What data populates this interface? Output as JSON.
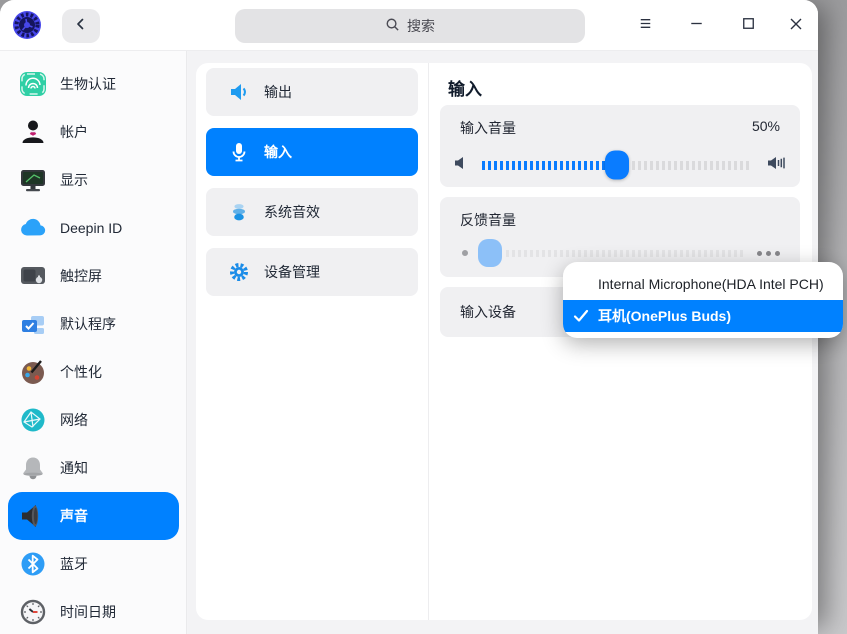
{
  "titlebar": {
    "search_placeholder": "搜索"
  },
  "sidebar": {
    "selected_index": 9,
    "items": [
      {
        "label": "生物认证",
        "icon": "fingerprint-icon",
        "selected": false
      },
      {
        "label": "帐户",
        "icon": "user-icon",
        "selected": false
      },
      {
        "label": "显示",
        "icon": "display-icon",
        "selected": false
      },
      {
        "label": "Deepin ID",
        "icon": "cloud-icon",
        "selected": false
      },
      {
        "label": "触控屏",
        "icon": "touchscreen-icon",
        "selected": false
      },
      {
        "label": "默认程序",
        "icon": "default-apps-icon",
        "selected": false
      },
      {
        "label": "个性化",
        "icon": "personalization-icon",
        "selected": false
      },
      {
        "label": "网络",
        "icon": "network-icon",
        "selected": false
      },
      {
        "label": "通知",
        "icon": "bell-icon",
        "selected": false
      },
      {
        "label": "声音",
        "icon": "speaker-icon",
        "selected": true
      },
      {
        "label": "蓝牙",
        "icon": "bluetooth-icon",
        "selected": false
      },
      {
        "label": "时间日期",
        "icon": "clock-icon",
        "selected": false
      }
    ]
  },
  "nav": {
    "selected_index": 1,
    "items": [
      {
        "label": "输出",
        "icon": "speaker-output-icon",
        "selected": false
      },
      {
        "label": "输入",
        "icon": "microphone-icon",
        "selected": true
      },
      {
        "label": "系统音效",
        "icon": "system-sound-icon",
        "selected": false
      },
      {
        "label": "设备管理",
        "icon": "gear-icon",
        "selected": false
      }
    ]
  },
  "panel": {
    "title": "输入",
    "input_volume": {
      "label": "输入音量",
      "value": "50%",
      "percent": 50
    },
    "feedback_volume": {
      "label": "反馈音量"
    },
    "input_device": {
      "label": "输入设备"
    }
  },
  "popup": {
    "options": [
      {
        "label": "Internal Microphone(HDA Intel PCH)",
        "selected": false
      },
      {
        "label": "耳机(OnePlus Buds)",
        "selected": true
      }
    ]
  },
  "colors": {
    "accent": "#0081ff",
    "card_background": "#f0f0f2",
    "slider_fill": "#0a7cff",
    "disabled_thumb": "#8cc0f8"
  }
}
